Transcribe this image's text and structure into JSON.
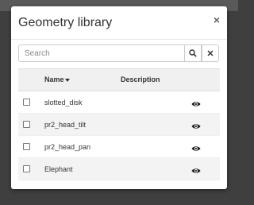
{
  "modal": {
    "title": "Geometry library",
    "close_icon": "close-icon",
    "close_label": "×"
  },
  "search": {
    "placeholder": "Search",
    "value": "",
    "search_icon": "magnifier-icon",
    "clear_icon": "close-icon",
    "clear_label": "✕"
  },
  "table": {
    "headers": {
      "name": "Name",
      "description": "Description"
    },
    "sort_icon": "caret-down-icon",
    "rows": [
      {
        "name": "slotted_disk",
        "description": "",
        "icon": "eye-icon"
      },
      {
        "name": "pr2_head_tilt",
        "description": "",
        "icon": "eye-icon"
      },
      {
        "name": "pr2_head_pan",
        "description": "",
        "icon": "eye-icon"
      },
      {
        "name": "Elephant",
        "description": "",
        "icon": "eye-icon"
      }
    ]
  },
  "colors": {
    "backdrop": "#3f3f3f",
    "header_bg": "#f0f0f0",
    "stripe": "#f3f3f3"
  }
}
